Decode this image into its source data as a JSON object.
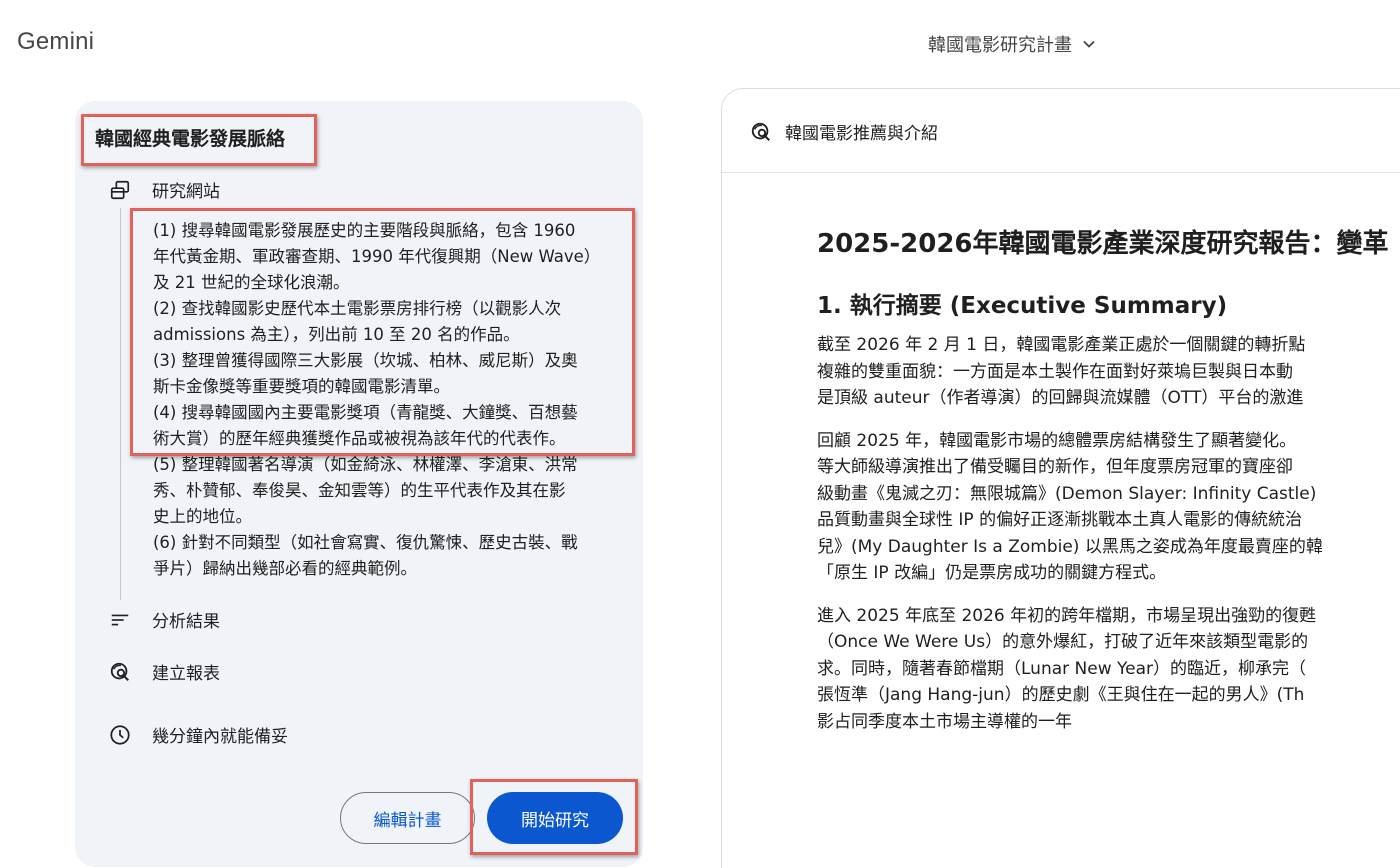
{
  "app": {
    "title": "Gemini"
  },
  "project": {
    "name": "韓國電影研究計畫"
  },
  "plan": {
    "title": "韓國經典電影發展脈絡",
    "steps": {
      "research": "研究網站",
      "analyze": "分析結果",
      "report": "建立報表",
      "eta": "幾分鐘內就能備妥"
    },
    "tasks": [
      [
        "(1) 搜尋韓國電影發展歷史的主要階段與脈絡，包含 1960",
        "年代黃金期、軍政審查期、1990 年代復興期（New Wave）",
        "及 21 世紀的全球化浪潮。"
      ],
      [
        "(2) 查找韓國影史歷代本土電影票房排行榜（以觀影人次",
        "admissions 為主），列出前 10 至 20 名的作品。"
      ],
      [
        "(3) 整理曾獲得國際三大影展（坎城、柏林、威尼斯）及奧",
        "斯卡金像獎等重要獎項的韓國電影清單。"
      ],
      [
        "(4) 搜尋韓國國內主要電影獎項（青龍獎、大鐘獎、百想藝",
        "術大賞）的歷年經典獲獎作品或被視為該年代的代表作。"
      ],
      [
        "(5) 整理韓國著名導演（如金綺泳、林權澤、李滄東、洪常",
        "秀、朴贊郁、奉俊昊、金知雲等）的生平代表作及其在影",
        "史上的地位。"
      ],
      [
        "(6) 針對不同類型（如社會寫實、復仇驚悚、歷史古裝、戰",
        "爭片）歸納出幾部必看的經典範例。"
      ]
    ],
    "buttons": {
      "edit": "編輯計畫",
      "start": "開始研究"
    }
  },
  "report": {
    "header": "韓國電影推薦與介紹",
    "title": "2025-2026年韓國電影產業深度研究報告：變革",
    "section1": "1. 執行摘要 (Executive Summary)",
    "paragraphs": [
      [
        "截至 2026 年 2 月 1 日，韓國電影產業正處於一個關鍵的轉折點",
        "複雜的雙重面貌：一方面是本土製作在面對好萊塢巨製與日本動",
        "是頂級 auteur（作者導演）的回歸與流媒體（OTT）平台的激進"
      ],
      [
        "回顧 2025 年，韓國電影市場的總體票房結構發生了顯著變化。",
        "等大師級導演推出了備受矚目的新作，但年度票房冠軍的寶座卻",
        "級動畫《鬼滅之刃：無限城篇》(Demon Slayer: Infinity Castle)",
        "品質動畫與全球性 IP 的偏好正逐漸挑戰本土真人電影的傳統統治",
        "兒》(My Daughter Is a Zombie) 以黑馬之姿成為年度最賣座的韓",
        "「原生 IP 改編」仍是票房成功的關鍵方程式。"
      ],
      [
        "進入 2025 年底至 2026 年初的跨年檔期，市場呈現出強勁的復甦",
        "（Once We Were Us）的意外爆紅，打破了近年來該類型電影的",
        "求。同時，隨著春節檔期（Lunar New Year）的臨近，柳承完（",
        "張恆準（Jang Hang-jun）的歷史劇《王與住在一起的男人》(Th",
        "影占同季度本土市場主導權的一年"
      ]
    ]
  },
  "colors": {
    "accent": "#0b57d0",
    "highlight": "#e0625a",
    "card_bg": "#f0f4f9"
  },
  "icons": [
    "chevron-down-icon",
    "web-research-icon",
    "analyze-lines-icon",
    "report-search-icon",
    "clock-icon"
  ]
}
